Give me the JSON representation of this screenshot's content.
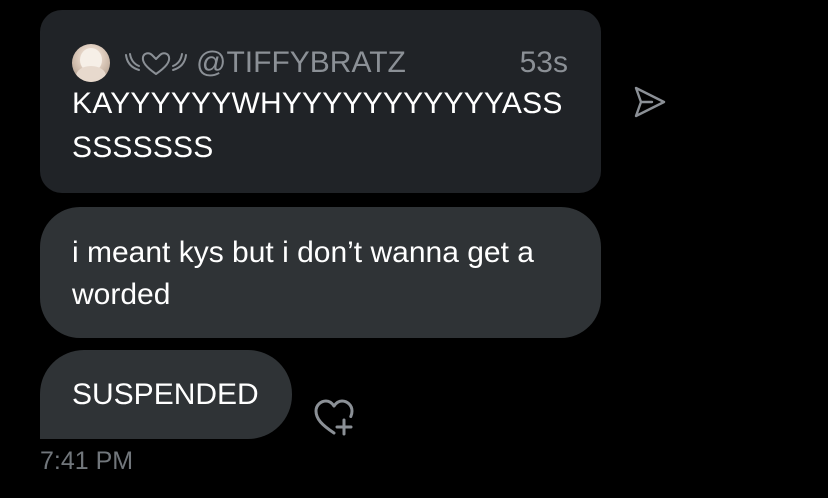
{
  "quoted_tweet": {
    "username": "@TIFFYBRATZ",
    "time_ago": "53s",
    "text": "KAYYYYYYWHYYYYYYYYYYYASSSSSSSSS"
  },
  "messages": [
    {
      "text": "i meant kys but i don’t wanna get a worded"
    },
    {
      "text": "SUSPENDED"
    }
  ],
  "footer": {
    "sent_time": "7:41 PM"
  },
  "icons": {
    "send": "send-icon",
    "react": "heart-plus-icon",
    "name_decoration": "heart-wings-icon"
  },
  "colors": {
    "background": "#000000",
    "bubble": "#2f3336",
    "quote_bubble": "#202327",
    "muted_text": "#8b9096"
  }
}
